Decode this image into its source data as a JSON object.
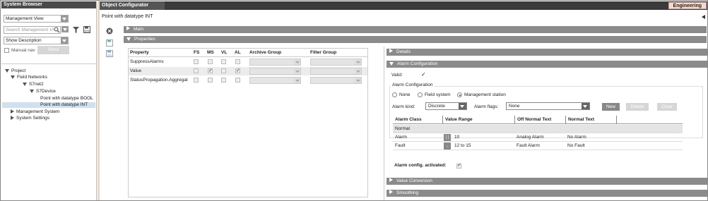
{
  "left": {
    "title": "System Browser",
    "view_select": "Management View",
    "search_placeholder": "Search Management Vi",
    "description_select": "Show Description",
    "manual_nav_label": "Manual nav",
    "send_label": "Send",
    "tree": [
      {
        "label": "Project",
        "level": 0,
        "state": "expanded"
      },
      {
        "label": "Field Networks",
        "level": 1,
        "state": "expanded"
      },
      {
        "label": "S7net2",
        "level": 2,
        "state": "expanded"
      },
      {
        "label": "S7Device",
        "level": 3,
        "state": "expanded"
      },
      {
        "label": "Point with datatype BOOL",
        "level": 4,
        "state": "leaf"
      },
      {
        "label": "Point with datatype INT",
        "level": 4,
        "state": "leaf",
        "selected": true
      },
      {
        "label": "Management System",
        "level": 1,
        "state": "collapsed"
      },
      {
        "label": "System Settings",
        "level": 1,
        "state": "collapsed"
      }
    ]
  },
  "right": {
    "tab_title": "Object Configurator",
    "engineering_label": "Engineering",
    "object_title": "Point with datatype INT",
    "main_section": "Main",
    "properties_section": "Properties",
    "prop_headers": {
      "property": "Property",
      "fs": "FS",
      "ms": "MS",
      "vl": "VL",
      "al": "AL",
      "archive": "Archive Group",
      "filter": "Filter Group"
    },
    "prop_rows": [
      {
        "name": "SuppressAlarms",
        "fs": false,
        "ms": false,
        "vl": false,
        "al": false
      },
      {
        "name": "Value",
        "fs": false,
        "ms": true,
        "vl": false,
        "al": true
      },
      {
        "name": "StatusPropagation.Aggregat",
        "fs": false,
        "ms": false,
        "vl": false,
        "al": false
      }
    ],
    "details_section": "Details",
    "alarm_section": "Alarm Configuration",
    "valid_label": "Valid:",
    "valid_checked": true,
    "alarm_config_group": "Alarm Configuration",
    "radios": [
      {
        "label": "None",
        "selected": false
      },
      {
        "label": "Field system",
        "selected": false
      },
      {
        "label": "Management station",
        "selected": true
      }
    ],
    "alarm_kind_label": "Alarm kind:",
    "alarm_kind_value": "Discrete",
    "alarm_flags_label": "Alarm flags:",
    "alarm_flags_value": "None",
    "new_label": "New",
    "delete_label": "Delete",
    "clear_label": "Clear",
    "alarm_headers": {
      "class": "Alarm Class",
      "range": "Value Range",
      "offnormal": "Off Normal Text",
      "normal": "Normal Text"
    },
    "alarm_rows": [
      {
        "class": "Normal",
        "button": "",
        "range": "",
        "offnormal": "",
        "normal": ""
      },
      {
        "class": "Alarm",
        "button": "| |",
        "range": "10",
        "offnormal": "Analog Alarm",
        "normal": "No Alarm"
      },
      {
        "class": "Fault",
        "button": "..",
        "range": "12  to  15",
        "offnormal": "Fault Alarm",
        "normal": "No Fault"
      }
    ],
    "alarm_activated_label": "Alarm config. activated:",
    "alarm_activated_checked": true,
    "value_conversion_section": "Value Conversion",
    "smoothing_section": "Smoothing"
  }
}
